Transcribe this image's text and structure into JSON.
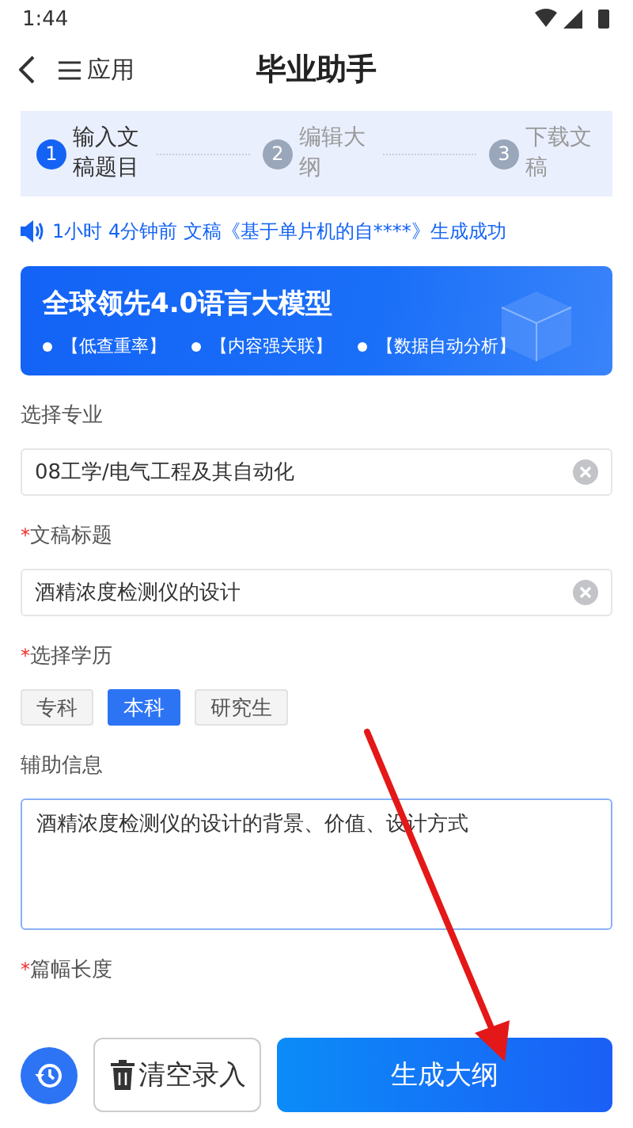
{
  "status_bar": {
    "time": "1:44"
  },
  "header": {
    "apps_label": "应用",
    "title": "毕业助手"
  },
  "steps": [
    {
      "number": "1",
      "label": "输入文稿题目",
      "selected": true
    },
    {
      "number": "2",
      "label": "编辑大纲",
      "selected": false
    },
    {
      "number": "3",
      "label": "下载文稿",
      "selected": false
    }
  ],
  "notice": "1小时 4分钟前 文稿《基于单片机的自****》生成成功",
  "banner": {
    "title": "全球领先4.0语言大模型",
    "points": [
      "【低查重率】",
      "【内容强关联】",
      "【数据自动分析】"
    ]
  },
  "fields": [
    {
      "kind": "input",
      "label": "选择专业",
      "value": "08工学/电气工程及其自动化"
    },
    {
      "kind": "input",
      "label": "文稿标题",
      "mark": "*",
      "value": "酒精浓度检测仪的设计"
    },
    {
      "kind": "chips",
      "label": "选择学历",
      "mark": "*",
      "options": [
        {
          "label": "专科",
          "selected": false
        },
        {
          "label": "本科",
          "selected": true
        },
        {
          "label": "研究生",
          "selected": false
        }
      ]
    },
    {
      "kind": "textarea",
      "label": "辅助信息",
      "value": "酒精浓度检测仪的设计的背景、价值、设计方式"
    },
    {
      "kind": "label",
      "label": "篇幅长度",
      "mark": "*"
    }
  ],
  "footer": {
    "clear_label": "清空录入",
    "generate_label": "生成大纲"
  },
  "annotation": {
    "kind": "arrow"
  }
}
